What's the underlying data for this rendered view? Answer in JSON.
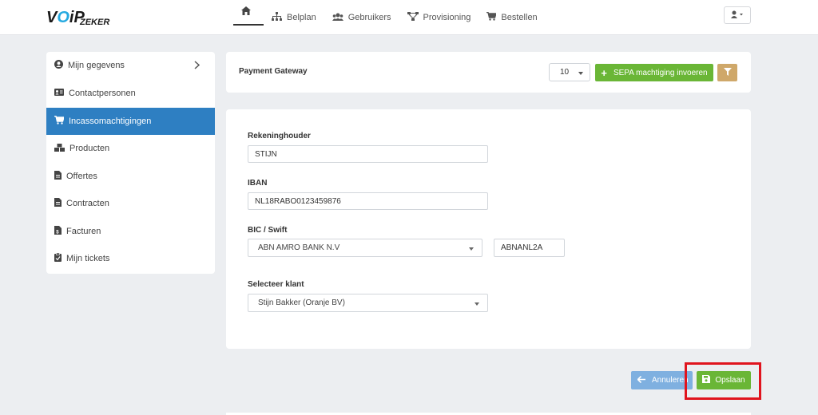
{
  "header": {
    "logo": {
      "part1": "VOiP",
      "part2": "ZEKER"
    },
    "nav": [
      {
        "label": "",
        "icon": "home-icon"
      },
      {
        "label": "Belplan",
        "icon": "sitemap-icon"
      },
      {
        "label": "Gebruikers",
        "icon": "users-icon"
      },
      {
        "label": "Provisioning",
        "icon": "network-icon"
      },
      {
        "label": "Bestellen",
        "icon": "cart-icon"
      }
    ],
    "user_menu": {
      "icon": "user-icon"
    }
  },
  "sidebar": {
    "items": [
      {
        "label": "Mijn gegevens",
        "icon": "user-circle-icon"
      },
      {
        "label": "Contactpersonen",
        "icon": "id-card-icon"
      },
      {
        "label": "Incassomachtigingen",
        "icon": "cart-icon",
        "active": true
      },
      {
        "label": "Producten",
        "icon": "boxes-icon"
      },
      {
        "label": "Offertes",
        "icon": "file-icon"
      },
      {
        "label": "Contracten",
        "icon": "file-icon"
      },
      {
        "label": "Facturen",
        "icon": "invoice-icon"
      },
      {
        "label": "Mijn tickets",
        "icon": "clipboard-check-icon"
      }
    ]
  },
  "toolbar": {
    "title": "Payment Gateway",
    "per_page": "10",
    "add_label": "SEPA machtiging invoeren"
  },
  "form": {
    "account_holder_label": "Rekeninghouder",
    "account_holder_value": "STIJN",
    "iban_label": "IBAN",
    "iban_value": "NL18RABO0123459876",
    "bic_label": "BIC / Swift",
    "bank_value": "ABN AMRO BANK N.V",
    "bic_value": "ABNANL2A",
    "customer_label": "Selecteer klant",
    "customer_value": "Stijn Bakker (Oranje BV)"
  },
  "actions": {
    "cancel_label": "Annuleren",
    "save_label": "Opslaan"
  },
  "colors": {
    "active_blue": "#2e7fc2",
    "green": "#6ab636",
    "filter_tan": "#cfa86a",
    "highlight_red": "#e0141e"
  }
}
